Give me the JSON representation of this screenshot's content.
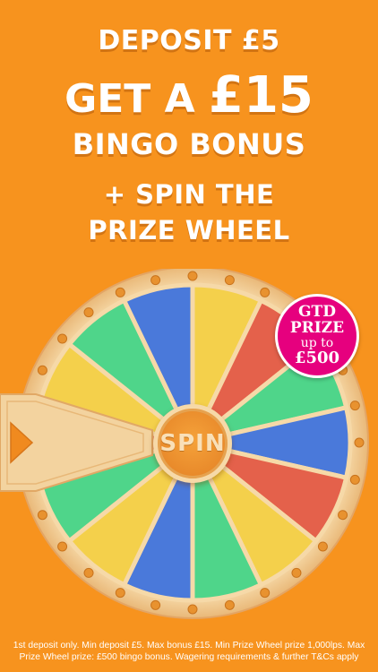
{
  "headline": {
    "line1": "DEPOSIT £5",
    "line2_prefix": "GET A ",
    "line2_amount": "£15",
    "line3": "BINGO BONUS",
    "line4": "+ SPIN THE",
    "line5": "PRIZE WHEEL"
  },
  "badge": {
    "line1": "GTD",
    "line2": "PRIZE",
    "line3": "up to",
    "line4": "£500"
  },
  "wheel": {
    "spin_label": "SPIN",
    "segment_colors": [
      "#E4614B",
      "#F4D04B",
      "#4FD58A",
      "#4A79DA",
      "#F4D04B",
      "#E4614B",
      "#4FD58A",
      "#4A79DA",
      "#E4614B",
      "#F4D04B",
      "#4FD58A",
      "#4A79DA",
      "#F4D04B",
      "#4FD58A"
    ],
    "pointer_icon": "triangle-pointer-icon"
  },
  "disclaimer": "1st deposit only. Min deposit £5. Max bonus £15. Min Prize Wheel prize 1,000lps. Max Prize Wheel prize: £500 bingo bonus. Wagering requirements & further T&Cs apply",
  "colors": {
    "background": "#F7931E",
    "badge": "#E6007E",
    "rim": "#F6D9A8"
  }
}
